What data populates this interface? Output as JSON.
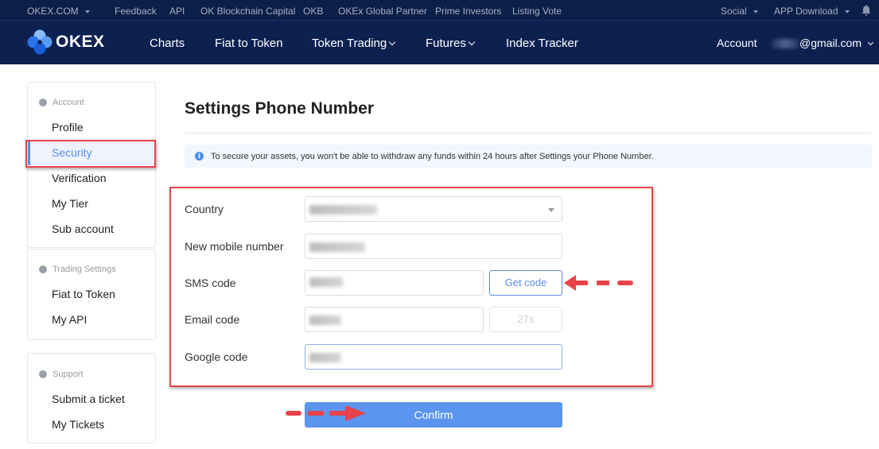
{
  "topbar": {
    "site": "OKEX.COM",
    "links": [
      "Feedback",
      "API",
      "OK Blockchain Capital",
      "OKB",
      "OKEx Global Partner",
      "Prime Investors",
      "Listing Vote"
    ],
    "social": "Social",
    "app_download": "APP Download"
  },
  "navbar": {
    "logo": "OKEX",
    "items": [
      "Charts",
      "Fiat to Token",
      "Token Trading",
      "Futures",
      "Index Tracker"
    ],
    "account": "Account",
    "email_suffix": "@gmail.com"
  },
  "sidebar": {
    "groups": [
      {
        "header": "Account",
        "items": [
          "Profile",
          "Security",
          "Verification",
          "My Tier",
          "Sub account"
        ],
        "active": "Security"
      },
      {
        "header": "Trading Settings",
        "items": [
          "Fiat to Token",
          "My API"
        ]
      },
      {
        "header": "Support",
        "items": [
          "Submit a ticket",
          "My Tickets"
        ]
      }
    ]
  },
  "main": {
    "title": "Settings Phone Number",
    "notice": "To secure your assets, you won't be able to withdraw any funds within 24 hours after Settings your Phone Number.",
    "form": {
      "country_label": "Country",
      "mobile_label": "New mobile number",
      "sms_label": "SMS code",
      "get_code": "Get code",
      "email_label": "Email code",
      "countdown": "27s",
      "google_label": "Google code"
    },
    "confirm": "Confirm"
  },
  "colors": {
    "nav_bg": "#0c2150",
    "topbar_bg": "#0b1f48",
    "accent": "#5b8de8",
    "confirm_bg": "#5b95ef",
    "highlight": "#e8434a"
  }
}
